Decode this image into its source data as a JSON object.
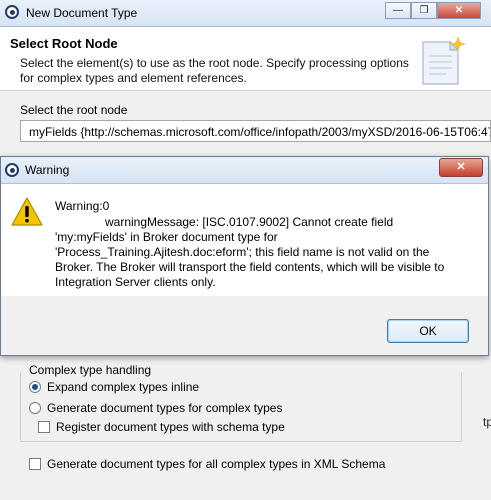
{
  "background_dialog": {
    "title": "New Document Type",
    "window_buttons": {
      "minimize": "—",
      "restore": "❐",
      "close": "✕"
    },
    "header_title": "Select Root Node",
    "header_description": "Select the element(s) to use as the root node. Specify processing options for complex types and element references.",
    "root_node_label": "Select the root node",
    "root_node_value": "myFields {http://schemas.microsoft.com/office/infopath/2003/myXSD/2016-06-15T06:47",
    "complex_group_label": "Complex type handling",
    "options": {
      "expand_inline": "Expand complex types inline",
      "generate_complex": "Generate document types for complex types",
      "register_schema": "Register document types with schema type",
      "generate_all": "Generate document types for all complex types in XML Schema"
    },
    "selected_option": "expand_inline",
    "right_fragment": "tp"
  },
  "warning_dialog": {
    "title": "Warning",
    "close_glyph": "✕",
    "heading": "Warning:0",
    "message": "warningMessage: [ISC.0107.9002] Cannot create field 'my:myFields' in Broker document type for 'Process_Training.Ajitesh.doc:eform'; this field name is not valid on the Broker.  The Broker will transport the field contents, which will be visible to Integration Server clients only.",
    "ok_label": "OK"
  },
  "icons": {
    "app": "app-logo-icon",
    "warning": "warning-triangle-icon",
    "wizard": "document-wizard-icon"
  },
  "colors": {
    "titlebar": "#d7e4f4",
    "close_button": "#c9483a",
    "warning_yellow": "#f5c400",
    "radio_selected": "#1a4d96"
  }
}
